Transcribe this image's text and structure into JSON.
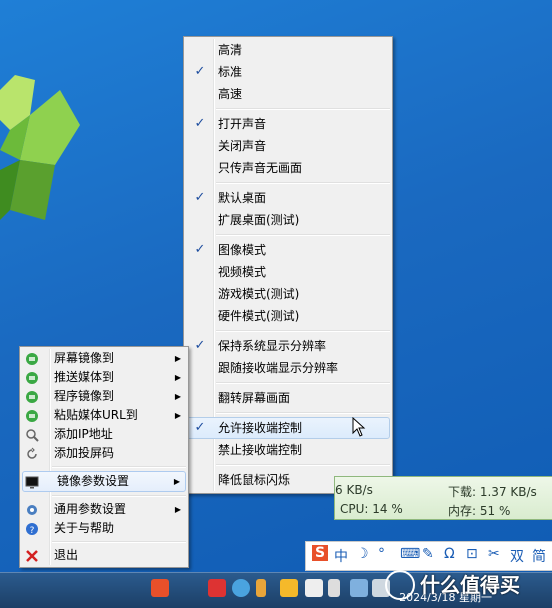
{
  "submenu": {
    "groups": [
      [
        {
          "label": "高清",
          "checked": false
        },
        {
          "label": "标准",
          "checked": true
        },
        {
          "label": "高速",
          "checked": false
        }
      ],
      [
        {
          "label": "打开声音",
          "checked": true
        },
        {
          "label": "关闭声音",
          "checked": false
        },
        {
          "label": "只传声音无画面",
          "checked": false
        }
      ],
      [
        {
          "label": "默认桌面",
          "checked": true
        },
        {
          "label": "扩展桌面(测试)",
          "checked": false
        }
      ],
      [
        {
          "label": "图像模式",
          "checked": true
        },
        {
          "label": "视频模式",
          "checked": false
        },
        {
          "label": "游戏模式(测试)",
          "checked": false
        },
        {
          "label": "硬件模式(测试)",
          "checked": false
        }
      ],
      [
        {
          "label": "保持系统显示分辨率",
          "checked": true
        },
        {
          "label": "跟随接收端显示分辨率",
          "checked": false
        }
      ],
      [
        {
          "label": "翻转屏幕画面",
          "checked": false
        }
      ],
      [
        {
          "label": "允许接收端控制",
          "checked": true
        },
        {
          "label": "禁止接收端控制",
          "checked": false
        }
      ],
      [
        {
          "label": "降低鼠标闪烁",
          "checked": false
        }
      ]
    ]
  },
  "mainmenu": {
    "items": [
      {
        "label": "屏幕镜像到",
        "icon": "mirror-icon",
        "submenu": true
      },
      {
        "label": "推送媒体到",
        "icon": "mirror-icon",
        "submenu": true
      },
      {
        "label": "程序镜像到",
        "icon": "mirror-icon",
        "submenu": true
      },
      {
        "label": "粘贴媒体URL到",
        "icon": "mirror-icon",
        "submenu": true
      },
      {
        "label": "添加IP地址",
        "icon": "magnifier-icon",
        "submenu": false
      },
      {
        "label": "添加投屏码",
        "icon": "refresh-icon",
        "submenu": false
      },
      {
        "label": "镜像参数设置",
        "icon": "monitor-icon",
        "submenu": true
      },
      {
        "label": "通用参数设置",
        "icon": "gear-icon",
        "submenu": true
      },
      {
        "label": "关于与帮助",
        "icon": "help-icon",
        "submenu": false
      },
      {
        "label": "退出",
        "icon": "close-icon",
        "submenu": false
      }
    ]
  },
  "netmon": {
    "upload": "6 KB/s",
    "download": "下载: 1.37 KB/s",
    "cpu": "CPU: 14 %",
    "mem": "内存: 51 %"
  },
  "ime": {
    "items": [
      "S",
      "中",
      "☽",
      "°",
      "⌨",
      "✎",
      "Ω",
      "⊡",
      "✂",
      "双",
      "简"
    ]
  },
  "taskbar": {
    "clock": "2024/3/18 星期一",
    "watermark": "什么值得买"
  }
}
